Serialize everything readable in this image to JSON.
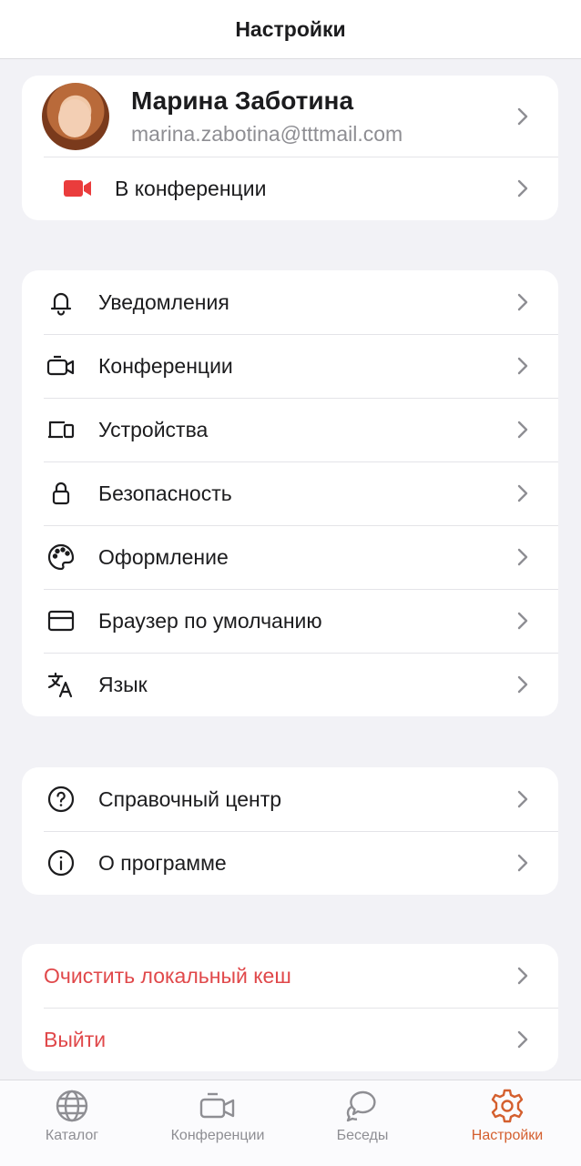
{
  "header": {
    "title": "Настройки"
  },
  "profile": {
    "name": "Марина Заботина",
    "email": "marina.zabotina@tttmail.com",
    "conference_label": "В конференции"
  },
  "settings_group": [
    {
      "label": "Уведомления",
      "icon": "bell-icon"
    },
    {
      "label": "Конференции",
      "icon": "video-camera-icon"
    },
    {
      "label": "Устройства",
      "icon": "devices-icon"
    },
    {
      "label": "Безопасность",
      "icon": "lock-icon"
    },
    {
      "label": "Оформление",
      "icon": "palette-icon"
    },
    {
      "label": "Браузер по умолчанию",
      "icon": "browser-window-icon"
    },
    {
      "label": "Язык",
      "icon": "translate-icon"
    }
  ],
  "help_group": [
    {
      "label": "Справочный центр",
      "icon": "question-circle-icon"
    },
    {
      "label": "О программе",
      "icon": "info-circle-icon"
    }
  ],
  "danger_group": [
    {
      "label": "Очистить локальный кеш"
    },
    {
      "label": "Выйти"
    }
  ],
  "tabs": [
    {
      "label": "Каталог",
      "icon": "globe-icon"
    },
    {
      "label": "Конференции",
      "icon": "video-camera-icon"
    },
    {
      "label": "Беседы",
      "icon": "chat-bubbles-icon"
    },
    {
      "label": "Настройки",
      "icon": "gear-icon",
      "active": true
    }
  ],
  "colors": {
    "accent": "#d45f2e",
    "danger": "#e0484a",
    "camera_red": "#ea3c3c",
    "background": "#f2f2f6"
  }
}
